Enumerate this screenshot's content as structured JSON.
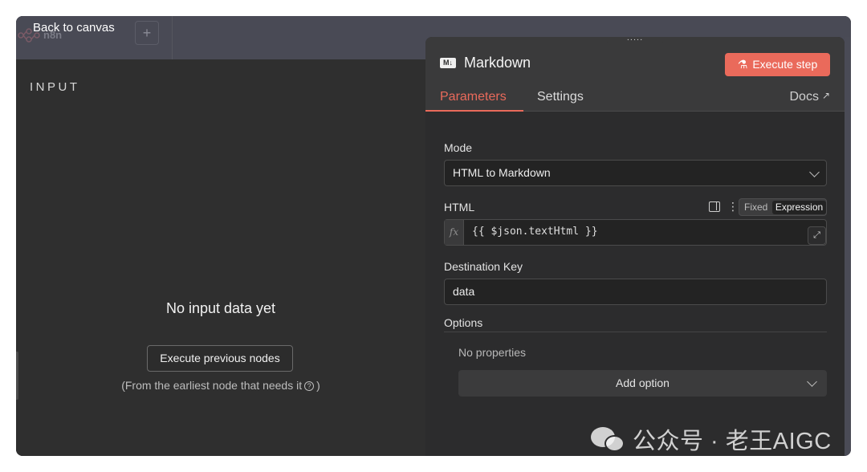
{
  "canvas": {
    "back_label": "Back to canvas",
    "brand": "n8n",
    "add_label": "+"
  },
  "input_pane": {
    "title": "INPUT",
    "empty_title": "No input data yet",
    "execute_previous_label": "Execute previous nodes",
    "note_prefix": "(From the earliest node that needs it",
    "note_suffix": ")"
  },
  "node_panel": {
    "drag_handle": ":::::",
    "icon_text": "M↓",
    "title": "Markdown",
    "execute_step_label": "Execute step",
    "tabs": [
      {
        "label": "Parameters",
        "active": true
      },
      {
        "label": "Settings",
        "active": false
      }
    ],
    "docs_label": "Docs",
    "mode": {
      "label": "Mode",
      "value": "HTML to Markdown"
    },
    "html": {
      "label": "HTML",
      "toggle_fixed": "Fixed",
      "toggle_expression": "Expression",
      "fx": "fx",
      "expression": "{{ $json.textHtml }}"
    },
    "destination_key": {
      "label": "Destination Key",
      "value": "data"
    },
    "options": {
      "label": "Options",
      "empty_label": "No properties",
      "add_label": "Add option"
    }
  },
  "watermark": {
    "text": "公众号 · 老王AIGC"
  },
  "colors": {
    "accent": "#ea6a5b",
    "panel_bg": "#2c2c2d",
    "input_bg": "#232323",
    "pane_bg": "#2f2f2f"
  }
}
